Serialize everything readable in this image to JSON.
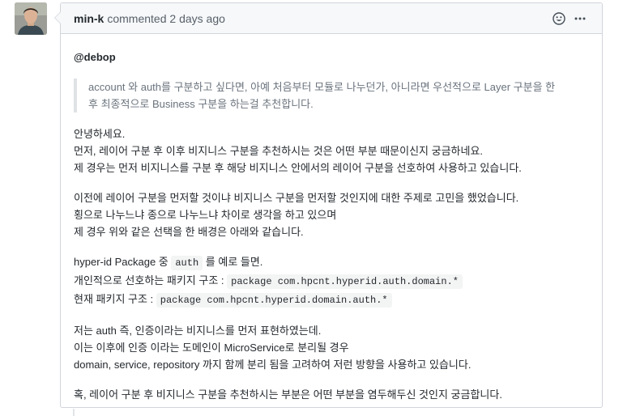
{
  "comment": {
    "author": "min-k",
    "action": "commented",
    "time": "2 days ago",
    "icons": {
      "reaction": "smiley-icon",
      "menu": "kebab-icon"
    }
  },
  "body": {
    "mention": "@debop",
    "quote": [
      "account 와 auth를 구분하고 싶다면, 아예 처음부터 모듈로 나누던가, 아니라면 우선적으로 Layer 구분을 한",
      "후 최종적으로 Business 구분을 하는걸 추천합니다."
    ],
    "para1": [
      "안녕하세요.",
      "먼저, 레이어 구분 후 이후 비지니스 구분을 추천하시는 것은 어떤 부분 때문이신지 궁금하네요.",
      "제 경우는 먼저 비지니스를 구분 후 해당 비지니스 안에서의 레이어 구분을 선호하여 사용하고 있습니다."
    ],
    "para2": [
      "이전에 레이어 구분을 먼저할 것이냐 비지니스 구분을 먼저할 것인지에 대한 주제로 고민을 했었습니다.",
      "횡으로 나누느냐 종으로 나누느냐 차이로 생각을 하고 있으며",
      "제 경우 위와 같은 선택을 한 배경은 아래와 같습니다."
    ],
    "para3": {
      "line1_prefix": "hyper-id Package 중 ",
      "line1_code": "auth",
      "line1_suffix": " 를 예로 들면.",
      "line2_prefix": "개인적으로 선호하는 패키지 구조 : ",
      "line2_code": "package com.hpcnt.hyperid.auth.domain.*",
      "line3_prefix": "현재 패키지 구조 : ",
      "line3_code": "package com.hpcnt.hyperid.domain.auth.*"
    },
    "para4": [
      "저는 auth 즉, 인증이라는 비지니스를 먼저 표현하였는데.",
      "이는 이후에 인증 이라는 도메인이 MicroService로 분리될 경우",
      "domain, service, repository 까지 함께 분리 됨을 고려하여 저런 방향을 사용하고 있습니다."
    ],
    "para5": "혹, 레이어 구분 후 비지니스 구분을 추천하시는 부분은 어떤 부분을 염두해두신 것인지 궁금합니다."
  }
}
